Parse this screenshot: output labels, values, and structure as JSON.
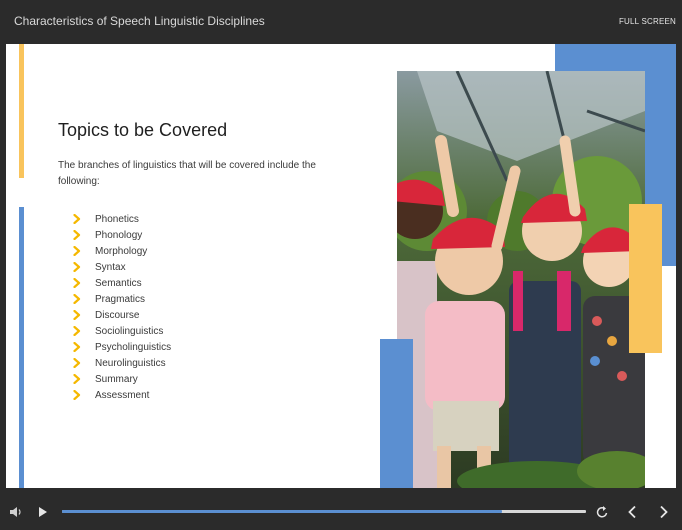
{
  "header": {
    "title": "Characteristics of Speech Linguistic Disciplines",
    "fullscreen_label": "FULL SCREEN"
  },
  "slide": {
    "title": "Topics to be Covered",
    "intro": "The branches of linguistics that will be covered include the following:",
    "topics": [
      "Phonetics",
      "Phonology",
      "Morphology",
      "Syntax",
      "Semantics",
      "Pragmatics",
      "Discourse",
      "Sociolinguistics",
      "Psycholinguistics",
      "Neurolinguistics",
      "Summary",
      "Assessment"
    ]
  },
  "player": {
    "progress_fraction": 0.84,
    "icons": [
      "volume-icon",
      "play-icon",
      "replay-icon",
      "previous-icon",
      "next-icon"
    ]
  },
  "colors": {
    "accent_blue": "#5b8fd1",
    "accent_yellow": "#f9c45c",
    "chevron": "#f5b800",
    "chrome": "#2b2b2b"
  }
}
